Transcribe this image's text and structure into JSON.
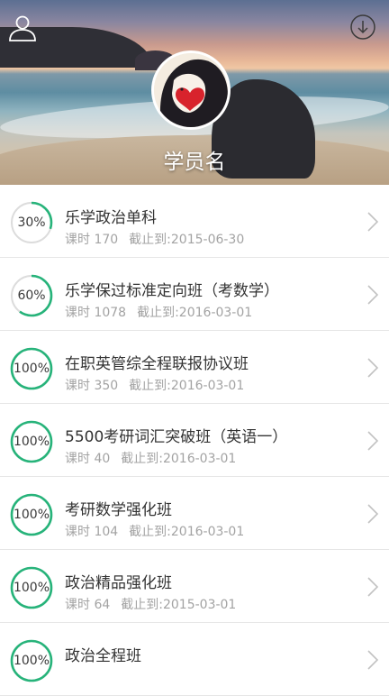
{
  "profile": {
    "username": "学员名"
  },
  "colors": {
    "ring_progress": "#27b37a",
    "ring_track": "#dcdcdc"
  },
  "courses": [
    {
      "progress_label": "30%",
      "progress": 0.3,
      "title": "乐学政治单科",
      "hours": "课时 170",
      "deadline": "截止到:2015-06-30"
    },
    {
      "progress_label": "60%",
      "progress": 0.6,
      "title": "乐学保过标准定向班（考数学）",
      "hours": "课时 1078",
      "deadline": "截止到:2016-03-01"
    },
    {
      "progress_label": "100%",
      "progress": 1.0,
      "title": "在职英管综全程联报协议班",
      "hours": "课时 350",
      "deadline": "截止到:2016-03-01"
    },
    {
      "progress_label": "100%",
      "progress": 1.0,
      "title": "5500考研词汇突破班（英语一）",
      "hours": "课时 40",
      "deadline": "截止到:2016-03-01"
    },
    {
      "progress_label": "100%",
      "progress": 1.0,
      "title": "考研数学强化班",
      "hours": "课时 104",
      "deadline": "截止到:2016-03-01"
    },
    {
      "progress_label": "100%",
      "progress": 1.0,
      "title": "政治精品强化班",
      "hours": "课时 64",
      "deadline": "截止到:2015-03-01"
    },
    {
      "progress_label": "100%",
      "progress": 1.0,
      "title": "政治全程班",
      "hours": "",
      "deadline": ""
    }
  ]
}
